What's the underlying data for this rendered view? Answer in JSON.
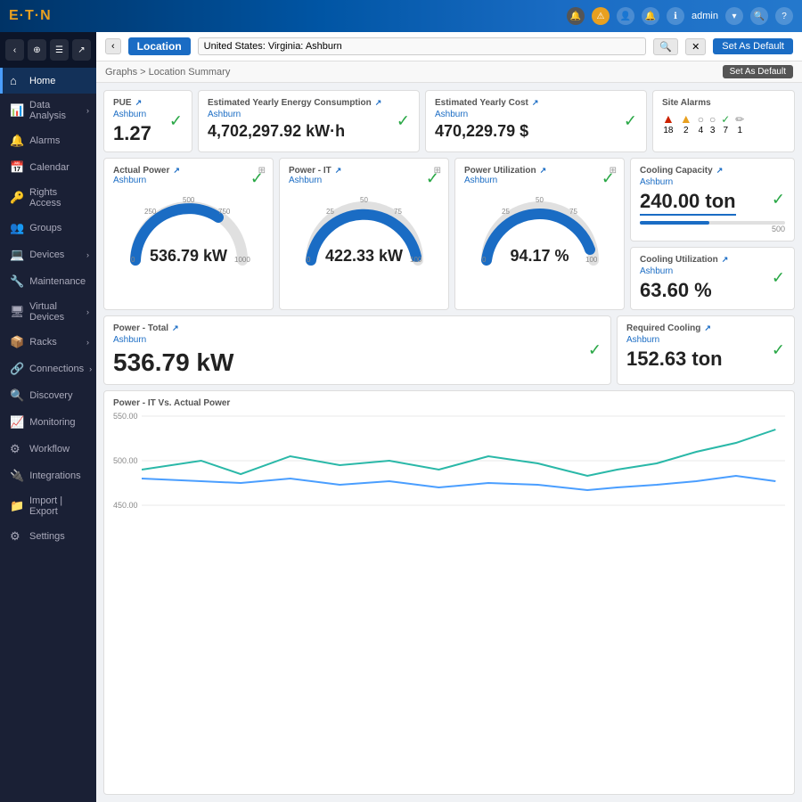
{
  "topnav": {
    "logo": "E·T·N",
    "logo_dot1": "·",
    "admin_label": "admin",
    "icons": [
      "🔔",
      "⚠",
      "👤",
      "🔔",
      "ℹ",
      "❓"
    ]
  },
  "sidebar": {
    "items": [
      {
        "id": "home",
        "label": "Home",
        "icon": "⌂",
        "active": true
      },
      {
        "id": "data-analysis",
        "label": "Data Analysis",
        "icon": "📊",
        "active": false
      },
      {
        "id": "alarms",
        "label": "Alarms",
        "icon": "🔔",
        "active": false
      },
      {
        "id": "calendar",
        "label": "Calendar",
        "icon": "📅",
        "active": false
      },
      {
        "id": "rights-access",
        "label": "Rights Access",
        "icon": "🔑",
        "active": false
      },
      {
        "id": "groups",
        "label": "Groups",
        "icon": "👥",
        "active": false
      },
      {
        "id": "devices",
        "label": "Devices",
        "icon": "💻",
        "active": false
      },
      {
        "id": "maintenance",
        "label": "Maintenance",
        "icon": "🔧",
        "active": false
      },
      {
        "id": "virtual-devices",
        "label": "Virtual Devices",
        "icon": "🖥",
        "active": false
      },
      {
        "id": "racks",
        "label": "Racks",
        "icon": "📦",
        "active": false
      },
      {
        "id": "connections",
        "label": "Connections",
        "icon": "🔗",
        "active": false
      },
      {
        "id": "discovery",
        "label": "Discovery",
        "icon": "🔍",
        "active": false
      },
      {
        "id": "monitoring",
        "label": "Monitoring",
        "icon": "📈",
        "active": false
      },
      {
        "id": "workflow",
        "label": "Workflow",
        "icon": "⚙",
        "active": false
      },
      {
        "id": "integrations",
        "label": "Integrations",
        "icon": "🔌",
        "active": false
      },
      {
        "id": "import-export",
        "label": "Import | Export",
        "icon": "📁",
        "active": false
      },
      {
        "id": "settings",
        "label": "Settings",
        "icon": "⚙",
        "active": false
      }
    ]
  },
  "location_bar": {
    "back_label": "‹",
    "location_label": "Location",
    "input_value": "United States: Virginia: Ashburn",
    "search_label": "🔍",
    "default_label": "Set As Default"
  },
  "breadcrumb": {
    "text": "Graphs > Location Summary",
    "set_default_label": "Set As Default"
  },
  "cards": {
    "pue": {
      "title": "PUE",
      "subtitle": "Ashburn",
      "value": "1.27"
    },
    "yearly_energy": {
      "title": "Estimated Yearly Energy Consumption",
      "subtitle": "Ashburn",
      "value": "4,702,297.92 kW·h"
    },
    "yearly_cost": {
      "title": "Estimated Yearly Cost",
      "subtitle": "Ashburn",
      "value": "470,229.79 $"
    },
    "site_alarms": {
      "title": "Site Alarms",
      "items": [
        {
          "icon": "🔴",
          "count": "18",
          "type": "critical"
        },
        {
          "icon": "🟠",
          "count": "2",
          "type": "warning"
        },
        {
          "icon": "○",
          "count": "4",
          "type": "info1"
        },
        {
          "icon": "○",
          "count": "3",
          "type": "info2"
        },
        {
          "icon": "✓",
          "count": "7",
          "type": "ok"
        },
        {
          "icon": "○",
          "count": "1",
          "type": "other"
        }
      ]
    },
    "actual_power": {
      "title": "Actual Power",
      "subtitle": "Ashburn",
      "value": "536.79 kW",
      "min": "0",
      "max": "1000",
      "current": 536.79,
      "ticks": [
        "0",
        "250",
        "500",
        "750",
        "1000"
      ],
      "percent": 53.7
    },
    "power_it": {
      "title": "Power - IT",
      "subtitle": "Ashburn",
      "value": "422.33 kW",
      "min": "0",
      "max": "400",
      "current": 422.33,
      "ticks": [
        "0",
        "25",
        "50",
        "75",
        "100"
      ],
      "percent": 100
    },
    "power_utilization": {
      "title": "Power Utilization",
      "subtitle": "Ashburn",
      "value": "94.17 %",
      "min": "0",
      "max": "100",
      "current": 94.17,
      "ticks": [
        "0",
        "25",
        "50",
        "75",
        "100"
      ],
      "percent": 94.17
    },
    "cooling_capacity": {
      "title": "Cooling Capacity",
      "subtitle": "Ashburn",
      "value": "240.00 ton",
      "bar_value": "500",
      "bar_percent": 48
    },
    "cooling_utilization": {
      "title": "Cooling Utilization",
      "subtitle": "Ashburn",
      "value": "63.60 %"
    },
    "power_total": {
      "title": "Power - Total",
      "subtitle": "Ashburn",
      "value": "536.79 kW"
    },
    "required_cooling": {
      "title": "Required Cooling",
      "subtitle": "Ashburn",
      "value": "152.63 ton"
    }
  },
  "chart": {
    "title": "Power - IT Vs. Actual Power",
    "y_max": "550.00",
    "y_mid": "500.00",
    "y_min": "450.00"
  }
}
